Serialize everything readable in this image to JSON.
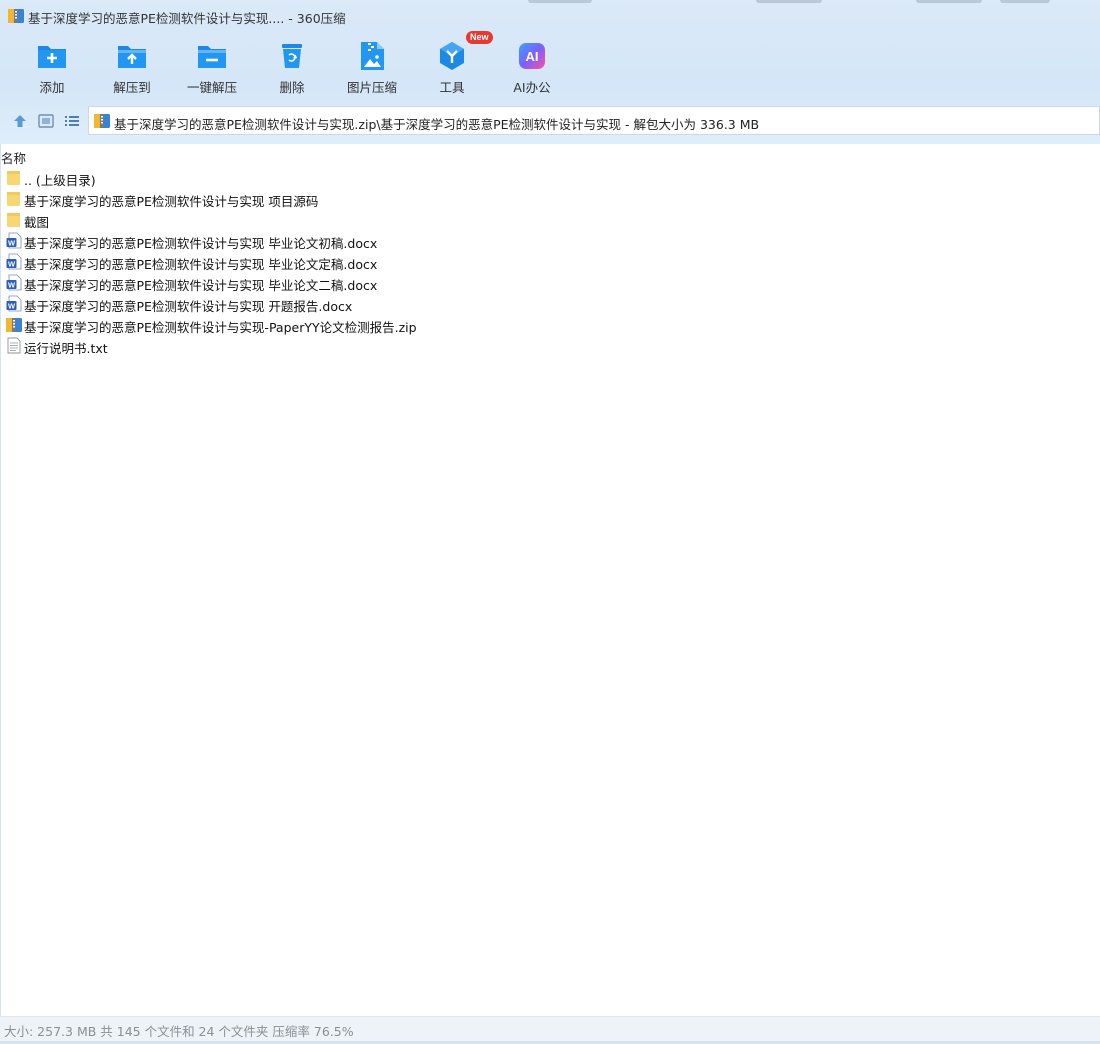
{
  "window": {
    "title": "基于深度学习的恶意PE检测软件设计与实现.... - 360压缩"
  },
  "toolbar": {
    "buttons": [
      {
        "label": "添加",
        "icon": "add-folder-icon"
      },
      {
        "label": "解压到",
        "icon": "extract-to-icon"
      },
      {
        "label": "一键解压",
        "icon": "one-click-extract-icon"
      },
      {
        "label": "删除",
        "icon": "recycle-bin-icon"
      },
      {
        "label": "图片压缩",
        "icon": "image-compress-icon"
      },
      {
        "label": "工具",
        "icon": "tools-icon",
        "badge": "New"
      },
      {
        "label": "AI办公",
        "icon": "ai-office-icon",
        "icon_text": "AI"
      }
    ]
  },
  "address": {
    "path": "基于深度学习的恶意PE检测软件设计与实现.zip\\基于深度学习的恶意PE检测软件设计与实现 - 解包大小为 336.3 MB"
  },
  "list": {
    "column_name": "名称",
    "items": [
      {
        "name": ".. (上级目录)",
        "type": "folder"
      },
      {
        "name": "基于深度学习的恶意PE检测软件设计与实现 项目源码",
        "type": "folder"
      },
      {
        "name": "截图",
        "type": "folder"
      },
      {
        "name": "基于深度学习的恶意PE检测软件设计与实现 毕业论文初稿.docx",
        "type": "docx"
      },
      {
        "name": "基于深度学习的恶意PE检测软件设计与实现 毕业论文定稿.docx",
        "type": "docx"
      },
      {
        "name": "基于深度学习的恶意PE检测软件设计与实现 毕业论文二稿.docx",
        "type": "docx"
      },
      {
        "name": "基于深度学习的恶意PE检测软件设计与实现 开题报告.docx",
        "type": "docx"
      },
      {
        "name": "基于深度学习的恶意PE检测软件设计与实现-PaperYY论文检测报告.zip",
        "type": "zip"
      },
      {
        "name": "运行说明书.txt",
        "type": "txt"
      }
    ]
  },
  "status": {
    "text": "大小: 257.3 MB 共 145 个文件和 24 个文件夹 压缩率 76.5%"
  },
  "colors": {
    "accent": "#1e88e5",
    "folder": "#f7d674",
    "word": "#2b5fb8",
    "badge": "#e8382f"
  }
}
